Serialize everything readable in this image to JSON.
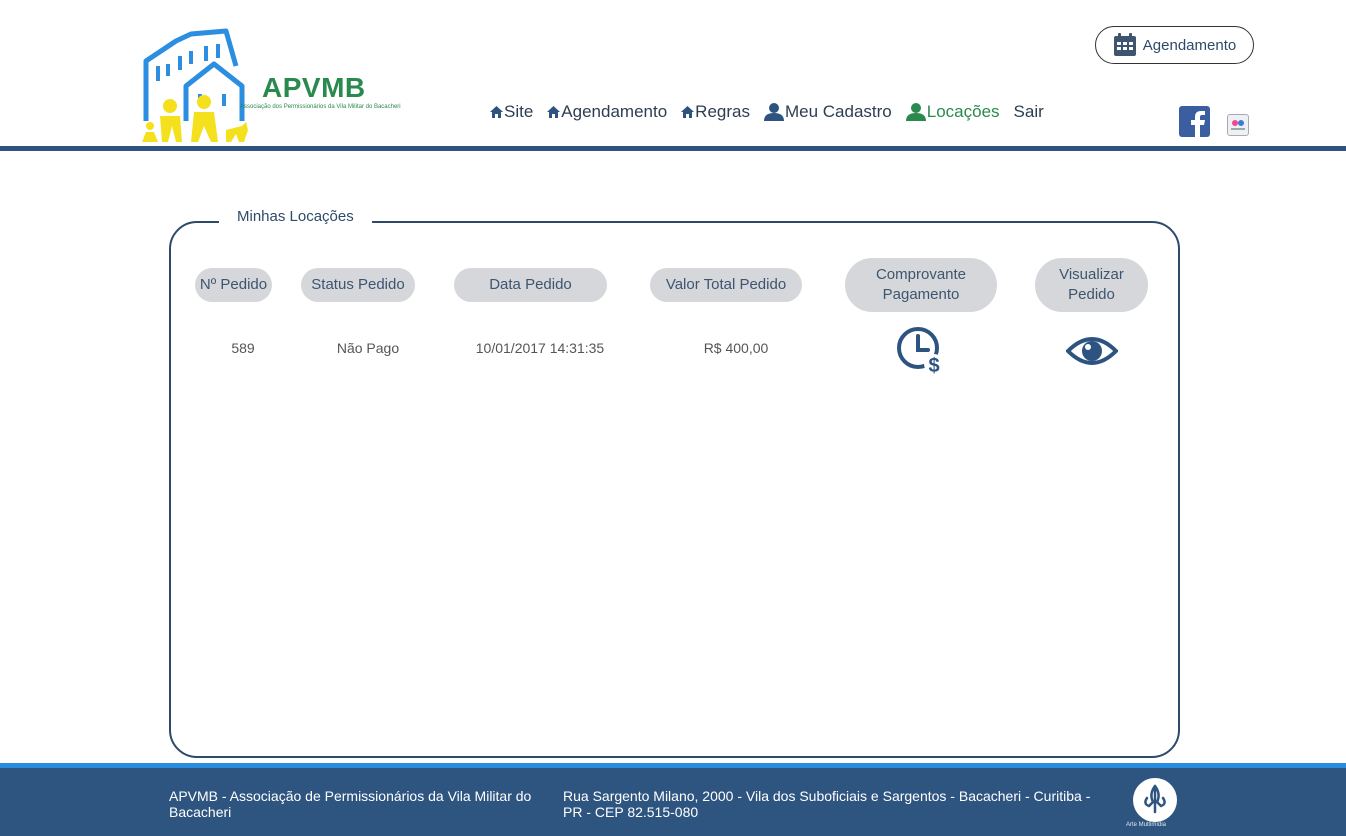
{
  "header": {
    "logo_title": "APVMB",
    "logo_subtitle": "Associação dos Permissionários da Vila Militar do Bacacheri",
    "agenda_button": "Agendamento",
    "nav": [
      {
        "label": "Site",
        "icon": "home-icon"
      },
      {
        "label": "Agendamento",
        "icon": "home-icon"
      },
      {
        "label": "Regras",
        "icon": "home-icon"
      },
      {
        "label": "Meu Cadastro",
        "icon": "user-icon"
      },
      {
        "label": "Locações",
        "icon": "user-icon",
        "active": true
      },
      {
        "label": "Sair"
      }
    ],
    "social": [
      "facebook-icon",
      "flickr-icon"
    ]
  },
  "panel": {
    "legend": "Minhas Locações",
    "columns": [
      "Nº Pedido",
      "Status Pedido",
      "Data Pedido",
      "Valor Total Pedido",
      "Comprovante Pagamento",
      "Visualizar Pedido"
    ],
    "rows": [
      {
        "numero": "589",
        "status": "Não Pago",
        "data": "10/01/2017 14:31:35",
        "valor": "R$ 400,00"
      }
    ]
  },
  "footer": {
    "left": "APVMB - Associação de Permissionários da Vila Militar do Bacacheri",
    "right": "Rua Sargento Milano, 2000 - Vila dos Suboficiais e Sargentos - Bacacheri - Curitiba - PR - CEP 82.515-080",
    "badge": "Arte Multimídia"
  },
  "colors": {
    "primary": "#2d5480",
    "accent_green": "#2a8a4e",
    "footer_line": "#2a8ee0",
    "header_pill": "#d5d7da"
  }
}
